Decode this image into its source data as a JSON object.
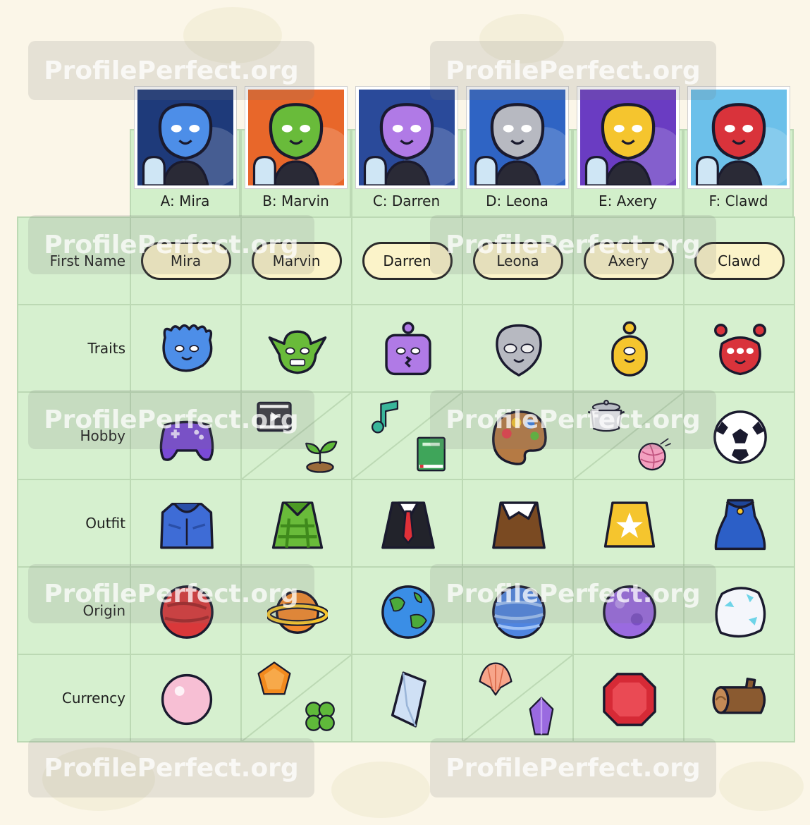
{
  "columns": [
    {
      "header": "A: Mira",
      "name": "Mira"
    },
    {
      "header": "B: Marvin",
      "name": "Marvin"
    },
    {
      "header": "C: Darren",
      "name": "Darren"
    },
    {
      "header": "D: Leona",
      "name": "Leona"
    },
    {
      "header": "E: Axery",
      "name": "Axery"
    },
    {
      "header": "F: Clawd",
      "name": "Clawd"
    }
  ],
  "rows": [
    "First Name",
    "Traits",
    "Hobby",
    "Outfit",
    "Origin",
    "Currency"
  ],
  "icons": {
    "traits": [
      "blue-tentacle-head-icon",
      "green-goblin-head-icon",
      "purple-robot-head-icon",
      "grey-alien-head-icon",
      "yellow-cyclops-head-icon",
      "red-three-eyed-head-icon"
    ],
    "hobby": [
      [
        "game-controller-icon"
      ],
      [
        "film-clapper-icon",
        "sprout-icon"
      ],
      [
        "music-note-icon",
        "book-icon"
      ],
      [
        "paint-palette-icon"
      ],
      [
        "cooking-pot-icon",
        "yarn-ball-icon"
      ],
      [
        "soccer-ball-icon"
      ]
    ],
    "outfit": [
      "blue-hoodie-icon",
      "green-plaid-shirt-icon",
      "black-suit-red-tie-icon",
      "brown-suit-icon",
      "yellow-star-shirt-icon",
      "blue-cape-icon"
    ],
    "origin": [
      "red-planet-icon",
      "ringed-orange-planet-icon",
      "earth-planet-icon",
      "blue-striped-planet-icon",
      "purple-planet-icon",
      "ice-planet-icon"
    ],
    "currency": [
      [
        "pink-pearl-icon"
      ],
      [
        "orange-gem-icon",
        "four-leaf-clover-icon"
      ],
      [
        "crystal-shard-icon"
      ],
      [
        "seashell-icon",
        "amethyst-icon"
      ],
      [
        "ruby-icon"
      ],
      [
        "wood-log-icon"
      ]
    ]
  },
  "watermark": "ProfilePerfect.org",
  "colors": {
    "grid_bg": "#d6f0cf",
    "grid_line": "#bcd9b4",
    "pill_bg": "#fbf3c9",
    "page_bg": "#fbf6e8"
  }
}
